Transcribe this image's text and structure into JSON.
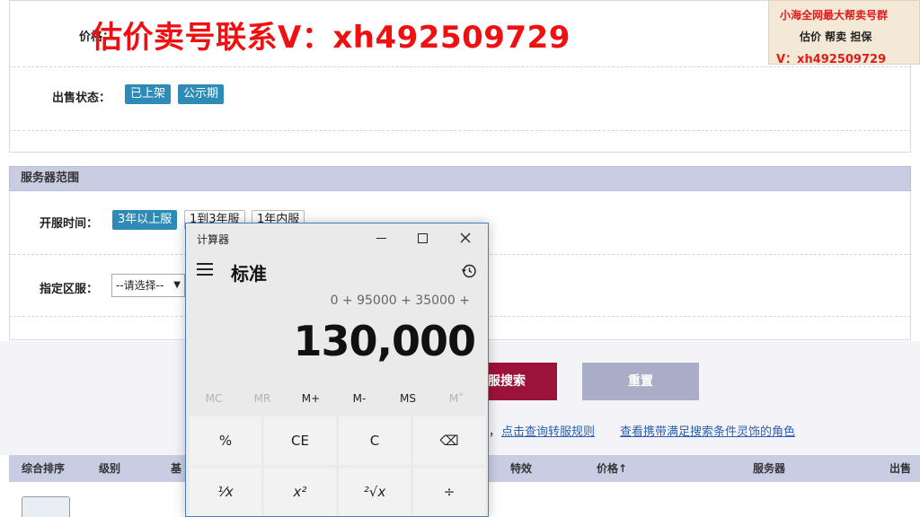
{
  "watermark": {
    "main_text": "估价卖号联系V：xh492509729",
    "corner_title": "小海全网最大帮卖号群",
    "corner_sub": "估价 帮卖 担保",
    "corner_contact": "V：xh492509729"
  },
  "web_page": {
    "price_label": "价格：",
    "sale_status": {
      "label": "出售状态：",
      "options": [
        "已上架",
        "公示期"
      ]
    },
    "server_range": {
      "header": "服务器范围",
      "open_time_label": "开服时间：",
      "open_time_options": [
        "3年以上服",
        "1到3年服",
        "1年内服"
      ],
      "region_label": "指定区服：",
      "region_placeholder": "--请选择--"
    },
    "search_button": "服搜索",
    "reset_button": "重置",
    "links": {
      "separator": "，",
      "transfer_rules": "点击查询转服规则",
      "view_roles": "查看携带满足搜索条件灵饰的角色"
    },
    "table_headers": [
      "综合排序",
      "级别",
      "基",
      "特效",
      "价格↑",
      "服务器",
      "出售"
    ]
  },
  "calculator": {
    "window_title": "计算器",
    "mode": "标准",
    "expression": "0 + 95000 + 35000 +",
    "display": "130,000",
    "memory_keys": [
      "MC",
      "MR",
      "M+",
      "M-",
      "MS",
      "M˅"
    ],
    "keys_row1": [
      "%",
      "CE",
      "C",
      "⌫"
    ],
    "keys_row2": [
      "¹⁄x",
      "x²",
      "²√x",
      "÷"
    ]
  },
  "colors": {
    "accent_blue": "#2e8bb5",
    "search_red": "#9c1339",
    "reset_gray": "#a9adc7",
    "header_lavender": "#c9cde4",
    "watermark_red": "#ee1111"
  }
}
